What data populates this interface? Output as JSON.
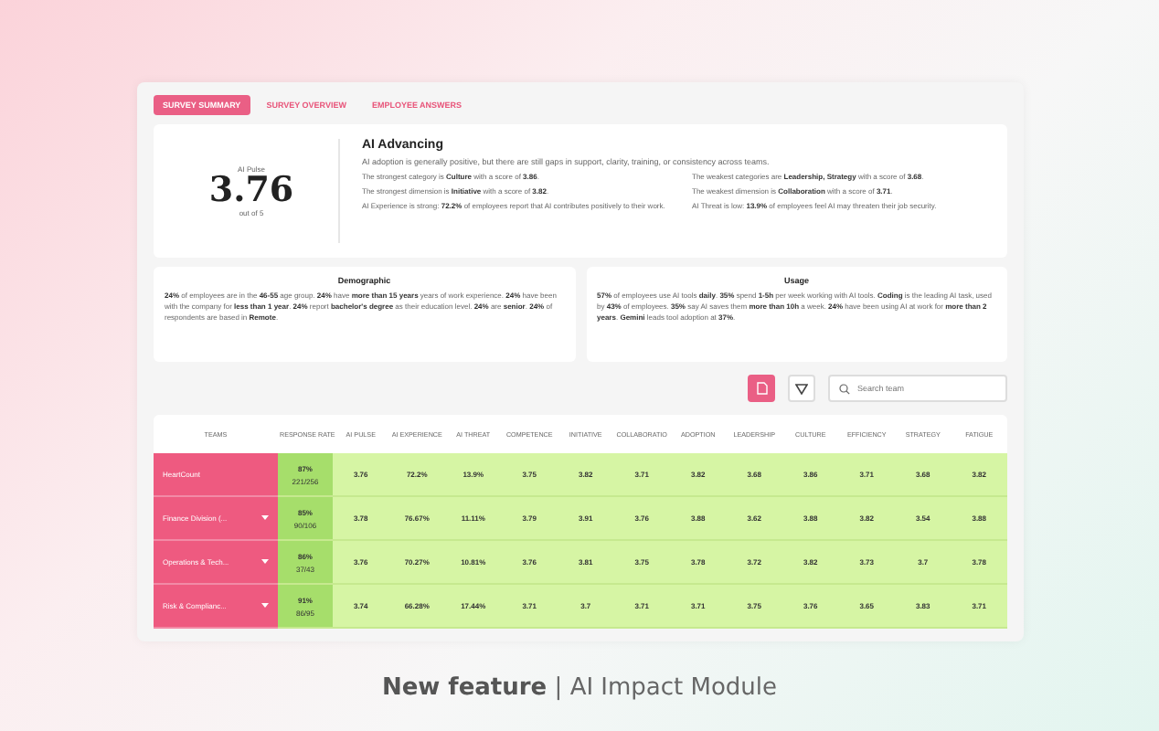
{
  "tabs": [
    {
      "label": "SURVEY SUMMARY",
      "selected": true
    },
    {
      "label": "SURVEY OVERVIEW",
      "selected": false
    },
    {
      "label": "EMPLOYEE ANSWERS",
      "selected": false
    }
  ],
  "pulse": {
    "label": "AI Pulse",
    "score": "3.76",
    "scale": "out of 5"
  },
  "summary": {
    "title": "AI Advancing",
    "intro": "AI adoption is generally positive, but there are still gaps in support, clarity, training, or consistency across teams.",
    "left": [
      "The strongest category is **Culture** with a score of **3.86**.",
      "The strongest dimension is **Initiative** with a score of **3.82**.",
      "AI Experience is strong: **72.2%** of employees report that AI contributes positively to their work."
    ],
    "right": [
      "The weakest categories are **Leadership, Strategy** with a score of **3.68**.",
      "The weakest dimension is **Collaboration** with a score of **3.71**.",
      "AI Threat is low: **13.9%** of employees feel AI may threaten their job security."
    ]
  },
  "cards": [
    {
      "title": "Demographic",
      "text": "**24%** of employees are in the **46-55** age group. **24%** have **more than 15 years** years of work experience. **24%** have been with the company for **less than 1 year**. **24%** report **bachelor's degree** as their education level. **24%** are **senior**. **24%** of respondents are based in **Remote**."
    },
    {
      "title": "Usage",
      "text": "**57%** of employees use AI tools **daily**. **35%** spend **1-5h** per week working with AI tools. **Coding** is the leading AI task, used by **43%** of employees. **35%** say AI saves them **more than 10h** a week. **24%** have been using AI at work for **more than 2 years**. **Gemini** leads tool adoption at **37%**."
    }
  ],
  "search": {
    "placeholder": "Search team"
  },
  "table": {
    "columns": [
      "TEAMS",
      "RESPONSE RATE",
      "AI PULSE",
      "AI EXPERIENCE",
      "AI THREAT",
      "COMPETENCE",
      "INITIATIVE",
      "COLLABORATIO",
      "ADOPTION",
      "LEADERSHIP",
      "CULTURE",
      "EFFICIENCY",
      "STRATEGY",
      "FATIGUE"
    ],
    "rows": [
      {
        "team": "HeartCount",
        "expandable": false,
        "rate": "87%",
        "count": "221/256",
        "values": [
          "3.76",
          "72.2%",
          "13.9%",
          "3.75",
          "3.82",
          "3.71",
          "3.82",
          "3.68",
          "3.86",
          "3.71",
          "3.68",
          "3.82"
        ]
      },
      {
        "team": "Finance Division (...",
        "expandable": true,
        "rate": "85%",
        "count": "90/106",
        "values": [
          "3.78",
          "76.67%",
          "11.11%",
          "3.79",
          "3.91",
          "3.76",
          "3.88",
          "3.62",
          "3.88",
          "3.82",
          "3.54",
          "3.88"
        ]
      },
      {
        "team": "Operations & Tech...",
        "expandable": true,
        "rate": "86%",
        "count": "37/43",
        "values": [
          "3.76",
          "70.27%",
          "10.81%",
          "3.76",
          "3.81",
          "3.75",
          "3.78",
          "3.72",
          "3.82",
          "3.73",
          "3.7",
          "3.78"
        ]
      },
      {
        "team": "Risk & Complianc...",
        "expandable": true,
        "rate": "91%",
        "count": "86/95",
        "values": [
          "3.74",
          "66.28%",
          "17.44%",
          "3.71",
          "3.7",
          "3.71",
          "3.71",
          "3.75",
          "3.76",
          "3.65",
          "3.83",
          "3.71"
        ]
      }
    ]
  },
  "caption": {
    "strong": "New feature",
    "separator": "|",
    "rest": "AI Impact Module"
  }
}
